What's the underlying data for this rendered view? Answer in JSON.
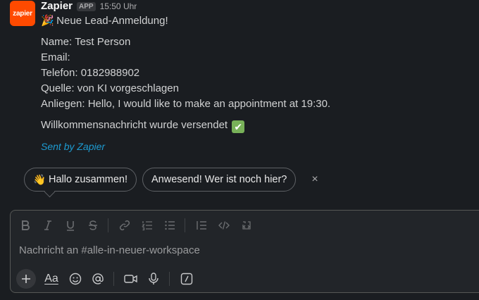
{
  "message": {
    "avatar_text": "zapier",
    "sender": "Zapier",
    "badge": "APP",
    "time": "15:50 Uhr",
    "title": "Neue Lead-Anmeldung!",
    "title_emoji": "🎉",
    "fields": {
      "name": "Name: Test Person",
      "email": "Email:",
      "phone": "Telefon: 0182988902",
      "source": "Quelle: von KI vorgeschlagen",
      "concern": "Anliegen: Hello, I would like to make an appointment at 19:30."
    },
    "welcome": "Willkommensnachricht wurde versendet",
    "welcome_emoji": "✔",
    "sent_by": "Sent by Zapier"
  },
  "suggestions": {
    "chip1_emoji": "👋",
    "chip1": "Hallo zusammen!",
    "chip2": "Anwesend! Wer ist noch hier?",
    "dismiss": "×"
  },
  "composer": {
    "placeholder": "Nachricht an #alle-in-neuer-workspace",
    "format_label": "Aa"
  },
  "colors": {
    "background": "#1a1d21",
    "zapier_orange": "#ff4a00",
    "link": "#1d9bd1",
    "checkmark": "#78b159"
  }
}
